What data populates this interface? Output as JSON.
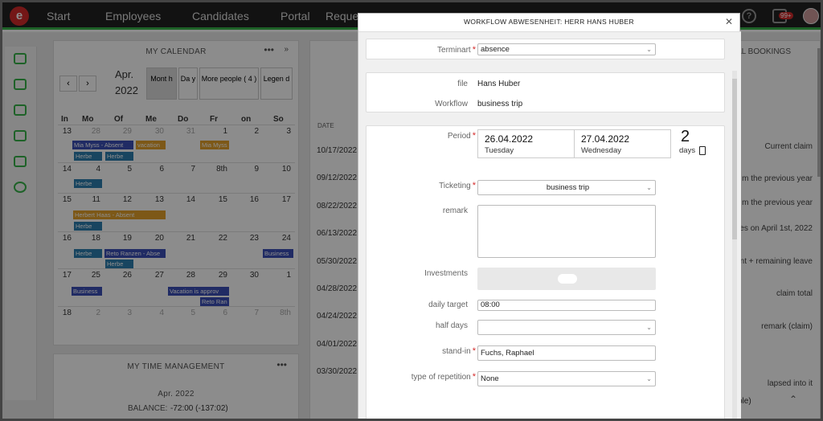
{
  "nav": {
    "items": [
      "Start",
      "Employees",
      "Candidates",
      "Portal",
      "Reque"
    ],
    "badge": "99+"
  },
  "calendar": {
    "title": "MY CALENDAR",
    "month": "Apr.",
    "year": "2022",
    "view_buttons": [
      "Mont h",
      "Da y",
      "More people ( 4 )",
      "Legen d"
    ],
    "weekday_headers": [
      "In",
      "Mo",
      "Of",
      "Me",
      "Do",
      "Fr",
      "on",
      "So"
    ],
    "weeks": [
      {
        "kw": "13",
        "days": [
          "28",
          "29",
          "30",
          "31",
          "1",
          "2",
          "3"
        ]
      },
      {
        "kw": "14",
        "days": [
          "4",
          "5",
          "6",
          "7",
          "8th",
          "9",
          "10"
        ]
      },
      {
        "kw": "15",
        "days": [
          "11",
          "12",
          "13",
          "14",
          "15",
          "16",
          "17"
        ]
      },
      {
        "kw": "16",
        "days": [
          "18",
          "19",
          "20",
          "21",
          "22",
          "23",
          "24"
        ]
      },
      {
        "kw": "17",
        "days": [
          "25",
          "26",
          "27",
          "28",
          "29",
          "30",
          "1"
        ]
      },
      {
        "kw": "18",
        "days": [
          "2",
          "3",
          "4",
          "5",
          "6",
          "7",
          "8th"
        ]
      }
    ],
    "events": {
      "mia1": "Mia Myss - Absent",
      "vacation": "vacation",
      "mia2": "Mia Myss",
      "herbe": "Herbe",
      "herbert": "Herbert Haas - Absent",
      "reto": "Reto Ranzen - Abse",
      "business": "Business",
      "vac_approved": "Vacation is approv",
      "reto2": "Reto Ran"
    }
  },
  "time_mgmt": {
    "title": "MY TIME MANAGEMENT",
    "period": "Apr. 2022",
    "balance_label": "BALANCE:",
    "balance_value": "-72:00 (-137:02)"
  },
  "bookings": {
    "title_partial": "AL BOOKINGS",
    "date_header": "DATE",
    "dates": [
      "10/17/2022",
      "09/12/2022",
      "08/22/2022",
      "06/13/2022",
      "05/30/2022",
      "04/28/2022",
      "04/24/2022",
      "04/01/2022",
      "03/30/2022"
    ],
    "right_labels": [
      "Current claim",
      "m the previous year",
      "m the previous year",
      "es on April 1st, 2022",
      "nt + remaining leave",
      "claim total",
      "remark (claim)",
      "lapsed into it"
    ],
    "bottom_partial": "ble)"
  },
  "modal": {
    "title": "WORKFLOW ABWESENHEIT: HERR HANS HUBER",
    "terminart_label": "Terminart",
    "terminart_value": "absence",
    "file_label": "file",
    "file_value": "Hans Huber",
    "workflow_label": "Workflow",
    "workflow_value": "business trip",
    "period_label": "Period",
    "period_start_date": "26.04.2022",
    "period_start_day": "Tuesday",
    "period_end_date": "27.04.2022",
    "period_end_day": "Wednesday",
    "period_count": "2",
    "period_unit": "days",
    "ticketing_label": "Ticketing",
    "ticketing_value": "business trip",
    "remark_label": "remark",
    "investments_label": "Investments",
    "daily_target_label": "daily target",
    "daily_target_value": "08:00",
    "half_days_label": "half days",
    "standin_label": "stand-in",
    "standin_value": "Fuchs, Raphael",
    "repetition_label": "type of repetition",
    "repetition_value": "None"
  }
}
